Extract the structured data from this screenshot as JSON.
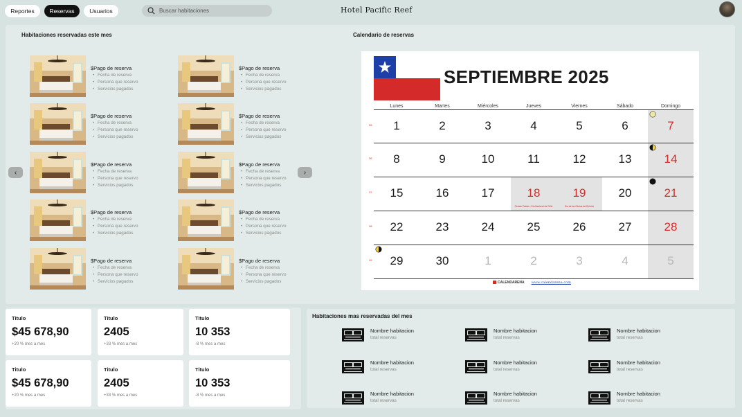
{
  "nav": {
    "tabs": [
      {
        "label": "Reportes",
        "active": false
      },
      {
        "label": "Reservas",
        "active": true
      },
      {
        "label": "Usuarios",
        "active": false
      }
    ],
    "search_placeholder": "Buscar habitaciones",
    "brand": "Hotel Pacific Reef"
  },
  "rooms_section": {
    "title": "Habitaciones reservadas este mes",
    "card": {
      "title": "$Pago de reserva",
      "lines": [
        "Fecha de reserva",
        "Persona que reservo",
        "Servicios pagados"
      ]
    }
  },
  "calendar_section": {
    "title": "Calendario de reservas",
    "month": "SEPTIEMBRE 2025",
    "weekdays": [
      "Lunes",
      "Martes",
      "Miércoles",
      "Jueves",
      "Viernes",
      "Sábado",
      "Domingo"
    ],
    "week_numbers": [
      "35",
      "36",
      "37",
      "38",
      "39"
    ],
    "weeks": [
      [
        "1",
        "2",
        "3",
        "4",
        "5",
        "6",
        "7"
      ],
      [
        "8",
        "9",
        "10",
        "11",
        "12",
        "13",
        "14"
      ],
      [
        "15",
        "16",
        "17",
        "18",
        "19",
        "20",
        "21"
      ],
      [
        "22",
        "23",
        "24",
        "25",
        "26",
        "27",
        "28"
      ],
      [
        "29",
        "30",
        "1",
        "2",
        "3",
        "4",
        "5"
      ]
    ],
    "holidays": {
      "18": "Fiestas Patrias - Día Nacional de Chile",
      "19": "Día de las Glorias del Ejército"
    },
    "footer_brand": "CALENDARENA",
    "footer_url": "www.calendarena.com",
    "accent_color": "#d42a2a"
  },
  "stats": [
    {
      "title": "Titulo",
      "value": "$45 678,90",
      "sub": "+20 % mes a mes"
    },
    {
      "title": "Titulo",
      "value": "2405",
      "sub": "+33 % mes a mes"
    },
    {
      "title": "Titulo",
      "value": "10 353",
      "sub": "-8 % mes a mes"
    },
    {
      "title": "Titulo",
      "value": "$45 678,90",
      "sub": "+20 % mes a mes"
    },
    {
      "title": "Titulo",
      "value": "2405",
      "sub": "+33 % mes a mes"
    },
    {
      "title": "Titulo",
      "value": "10 353",
      "sub": "-8 % mes a mes"
    }
  ],
  "most_reserved": {
    "title": "Habitaciones mas reservadas del mes",
    "item": {
      "name": "Nombre habitacion",
      "sub": "total reservas",
      "icon": "bed-icon"
    }
  }
}
